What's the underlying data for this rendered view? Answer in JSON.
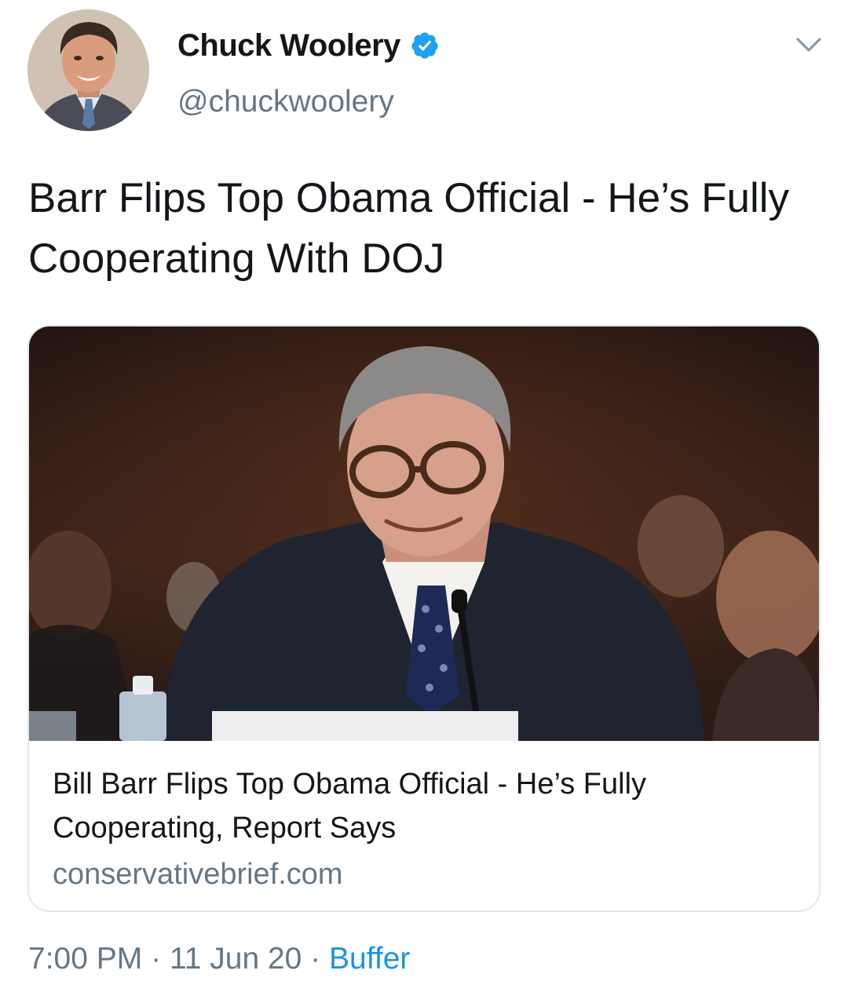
{
  "author": {
    "display_name": "Chuck Woolery",
    "handle": "@chuckwoolery",
    "verified": true
  },
  "tweet_text": "Barr Flips Top Obama Official - He’s Fully Cooperating With DOJ",
  "card": {
    "title": "Bill Barr Flips Top Obama Official - He’s Fully Cooperating, Report Says",
    "domain": "conservativebrief.com"
  },
  "footer": {
    "time": "7:00 PM",
    "separator": "·",
    "date": "11 Jun 20",
    "source": "Buffer"
  },
  "icons": {
    "verified": "verified-badge-icon",
    "menu": "chevron-down-icon"
  },
  "colors": {
    "link": "#1b95e0",
    "secondary_text": "#657786",
    "verified": "#1da1f2",
    "border": "#e1e8ed"
  }
}
